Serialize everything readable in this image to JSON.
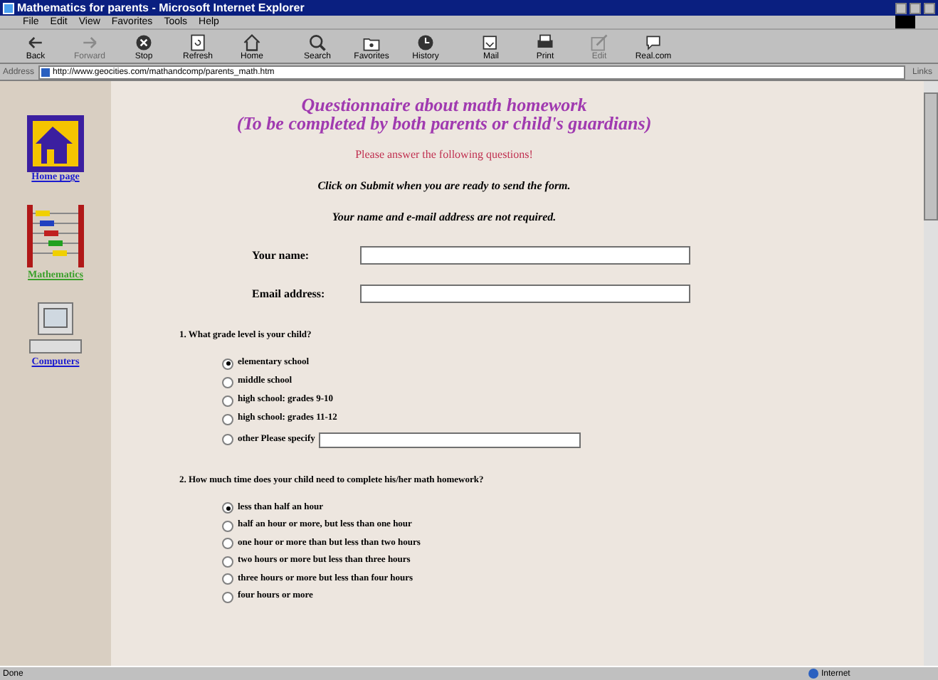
{
  "window": {
    "title": "Mathematics for parents - Microsoft Internet Explorer"
  },
  "menu": [
    "File",
    "Edit",
    "View",
    "Favorites",
    "Tools",
    "Help"
  ],
  "toolbar": [
    {
      "label": "Back",
      "kind": "back",
      "disabled": false
    },
    {
      "label": "Forward",
      "kind": "forward",
      "disabled": true
    },
    {
      "label": "Stop",
      "kind": "stop",
      "disabled": false
    },
    {
      "label": "Refresh",
      "kind": "refresh",
      "disabled": false
    },
    {
      "label": "Home",
      "kind": "home",
      "disabled": false
    },
    {
      "label": "Search",
      "kind": "search",
      "disabled": false
    },
    {
      "label": "Favorites",
      "kind": "favorites",
      "disabled": false
    },
    {
      "label": "History",
      "kind": "history",
      "disabled": false
    },
    {
      "label": "Mail",
      "kind": "mail",
      "disabled": false
    },
    {
      "label": "Print",
      "kind": "print",
      "disabled": false
    },
    {
      "label": "Edit",
      "kind": "edit",
      "disabled": true
    },
    {
      "label": "Real.com",
      "kind": "chat",
      "disabled": false
    }
  ],
  "address": {
    "label": "Address",
    "url": "http://www.geocities.com/mathandcomp/parents_math.htm",
    "links": "Links"
  },
  "sidebar": [
    {
      "label": "Home page",
      "kind": "home",
      "color": "#1a1ad0"
    },
    {
      "label": "Mathematics",
      "kind": "abacus",
      "color": "#3aa02a"
    },
    {
      "label": "Computers",
      "kind": "computer",
      "color": "#1a1ad0"
    }
  ],
  "heading": [
    "Questionnaire about math homework",
    "(To be completed by both parents or child's guardians)"
  ],
  "intro": "Please answer the following questions!",
  "notes": [
    "Click on Submit when you are ready to send the form.",
    "Your name and e-mail address are not required."
  ],
  "fields": [
    {
      "label": "Your name:"
    },
    {
      "label": "Email address:"
    }
  ],
  "questions": [
    {
      "text": "1. What grade level is your child?",
      "options": [
        {
          "label": "elementary school",
          "selected": true
        },
        {
          "label": "middle school",
          "selected": false
        },
        {
          "label": "high school: grades 9-10",
          "selected": false
        },
        {
          "label": "high school: grades 11-12",
          "selected": false
        },
        {
          "label": "other Please specify",
          "selected": false,
          "kind": "other"
        }
      ]
    },
    {
      "text": "2. How much time does your child need to complete his/her math homework?",
      "options": [
        {
          "label": "less than half an hour",
          "selected": true
        },
        {
          "label": "half an hour or more, but less than one hour",
          "selected": false
        },
        {
          "label": "one hour or more than but less than two hours",
          "selected": false
        },
        {
          "label": "two hours or more but less than three hours",
          "selected": false
        },
        {
          "label": "three hours or more but less than four hours",
          "selected": false
        },
        {
          "label": "four hours or more",
          "selected": false
        }
      ]
    }
  ],
  "status_bar": {
    "text": "Done",
    "zone": "Internet"
  }
}
